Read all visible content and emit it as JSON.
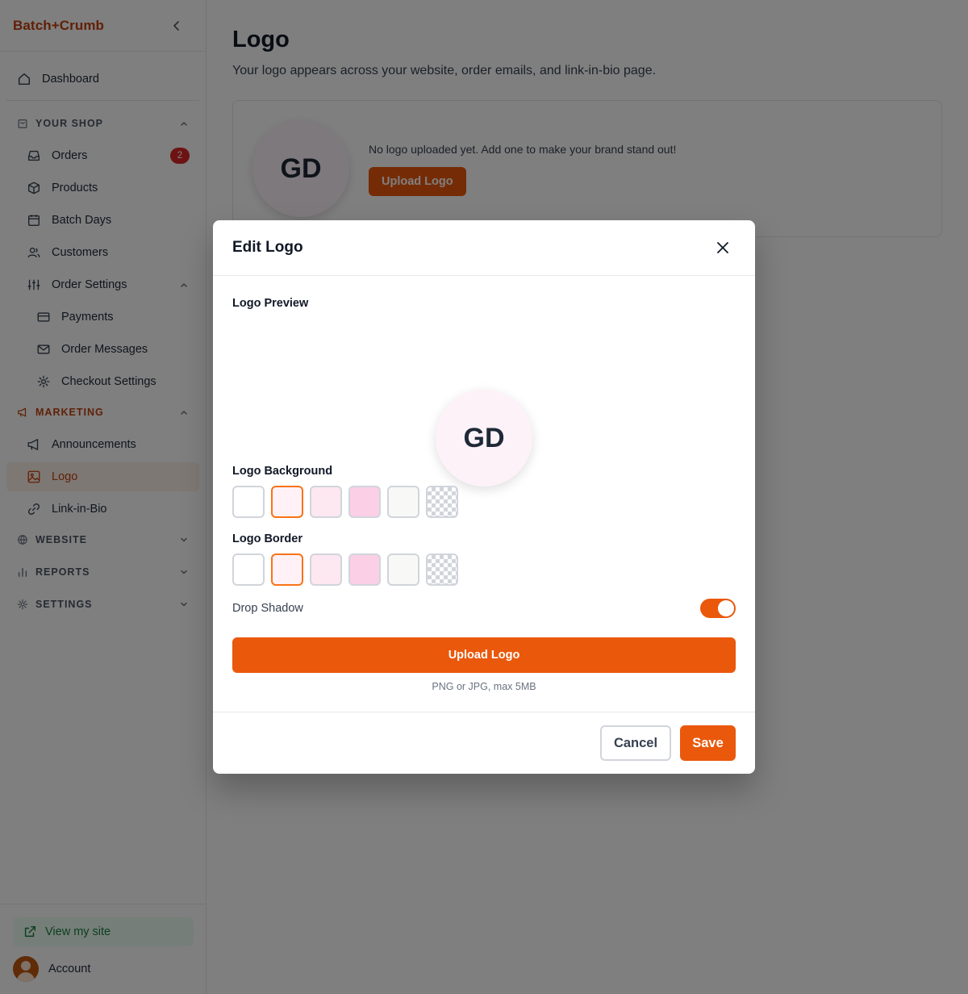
{
  "brand": "Batch+Crumb",
  "colors": {
    "accent": "#ea580c",
    "brand_text": "#c2410c",
    "badge": "#dc2626"
  },
  "sidebar": {
    "dashboard": "Dashboard",
    "sections": {
      "your_shop": "YOUR SHOP",
      "marketing": "MARKETING",
      "website": "WEBSITE",
      "reports": "REPORTS",
      "settings": "SETTINGS"
    },
    "items": {
      "orders": "Orders",
      "orders_badge": "2",
      "products": "Products",
      "batch_days": "Batch Days",
      "customers": "Customers",
      "order_settings": "Order Settings",
      "payments": "Payments",
      "order_messages": "Order Messages",
      "checkout_settings": "Checkout Settings",
      "announcements": "Announcements",
      "logo": "Logo",
      "link_in_bio": "Link-in-Bio"
    },
    "footer": {
      "view_site": "View my site",
      "account": "Account"
    }
  },
  "page": {
    "title": "Logo",
    "subtitle": "Your logo appears across your website, order emails, and link-in-bio page.",
    "initials": "GD",
    "empty_message": "No logo uploaded yet. Add one to make your brand stand out!",
    "upload_label": "Upload Logo"
  },
  "modal": {
    "title": "Edit Logo",
    "preview_label": "Logo Preview",
    "initials": "GD",
    "background_label": "Logo Background",
    "border_label": "Logo Border",
    "swatch_colors": [
      "#ffffff",
      "#fff1f6",
      "#fde7f1",
      "#fbcfe6",
      "#f8f8f6",
      "transparent"
    ],
    "selected_background_index": 1,
    "selected_border_index": 1,
    "drop_shadow_label": "Drop Shadow",
    "drop_shadow_on": true,
    "upload_label": "Upload Logo",
    "upload_hint": "PNG or JPG, max 5MB",
    "cancel_label": "Cancel",
    "save_label": "Save"
  }
}
